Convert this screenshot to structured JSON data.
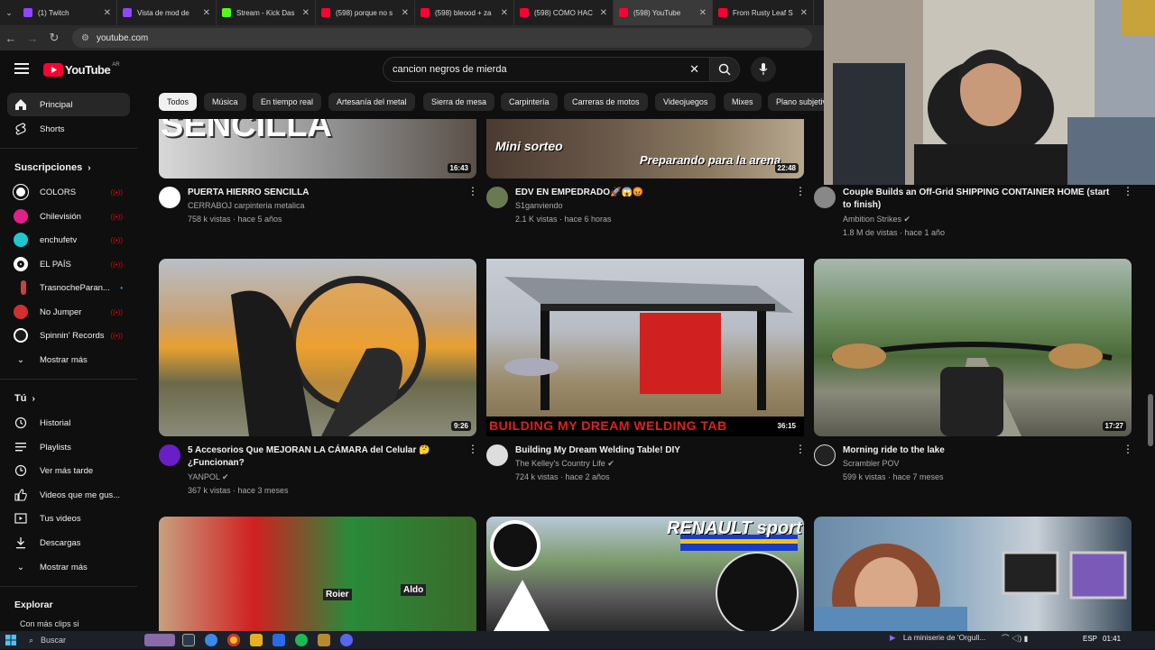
{
  "browser": {
    "tabs": [
      {
        "label": "(1) Twitch",
        "color": "#9146ff",
        "active": false
      },
      {
        "label": "Vista de mod de",
        "color": "#9146ff",
        "active": false
      },
      {
        "label": "Stream - Kick Das",
        "color": "#53fc18",
        "active": false
      },
      {
        "label": "(598) porque no s",
        "color": "#ff0033",
        "active": false
      },
      {
        "label": "(598) bleood + za",
        "color": "#ff0033",
        "active": false
      },
      {
        "label": "(598) CÓMO HAC",
        "color": "#ff0033",
        "active": false
      },
      {
        "label": "(598) YouTube",
        "color": "#ff0033",
        "active": true
      },
      {
        "label": "From Rusty Leaf S",
        "color": "#ff0033",
        "active": false
      }
    ],
    "url": "youtube.com"
  },
  "youtube": {
    "logo_text": "YouTube",
    "region": "AR",
    "search_query": "cancion negros de mierda",
    "accent": "#ff0033"
  },
  "sidebar": {
    "main": [
      {
        "label": "Principal",
        "icon": "home-icon"
      },
      {
        "label": "Shorts",
        "icon": "shorts-icon"
      }
    ],
    "subscriptions_title": "Suscripciones",
    "subscriptions": [
      {
        "label": "COLORS",
        "color": "#ffffff",
        "live": true
      },
      {
        "label": "Chilevisión",
        "color": "#e0218a",
        "live": true
      },
      {
        "label": "enchufetv",
        "color": "#1ec8d0",
        "live": true
      },
      {
        "label": "EL PAÍS",
        "color": "#ffffff",
        "live": true
      },
      {
        "label": "TrasnocheParan...",
        "color": "#c84040",
        "live": false
      },
      {
        "label": "No Jumper",
        "color": "#d03030",
        "live": true
      },
      {
        "label": "Spinnin' Records",
        "color": "#1a1a1a",
        "live": true
      }
    ],
    "show_more_subs": "Mostrar más",
    "you_title": "Tú",
    "you_items": [
      {
        "label": "Historial",
        "icon": "history-icon"
      },
      {
        "label": "Playlists",
        "icon": "playlists-icon"
      },
      {
        "label": "Ver más tarde",
        "icon": "watch-later-icon"
      },
      {
        "label": "Videos que me gus...",
        "icon": "like-icon"
      },
      {
        "label": "Tus videos",
        "icon": "your-videos-icon"
      },
      {
        "label": "Descargas",
        "icon": "download-icon"
      }
    ],
    "show_more_you": "Mostrar más",
    "explore_title": "Explorar",
    "bottom_text": "Con más clips si"
  },
  "chips": [
    "Todos",
    "Música",
    "En tiempo real",
    "Artesanía del metal",
    "Sierra de mesa",
    "Carpintería",
    "Carreras de motos",
    "Videojuegos",
    "Mixes",
    "Plano subjetivo"
  ],
  "videos": [
    {
      "title": "PUERTA HIERRO SENCILLA",
      "channel": "CERRABOJ carpinteria metalica",
      "meta": "758 k vistas · hace 5 años",
      "duration": "16:43",
      "thumb_text": "SENCILLA",
      "verified": false
    },
    {
      "title": "EDV EN EMPEDRADO🚀😱😡",
      "channel": "S1ganviendo",
      "meta": "2.1 K vistas · hace 6 horas",
      "duration": "22:48",
      "thumb_text": "Mini sorteo",
      "thumb_text2": "Preparando para la arena",
      "verified": false
    },
    {
      "title": "Couple Builds an Off-Grid SHIPPING CONTAINER HOME (start to finish)",
      "channel": "Ambition Strikes",
      "meta": "1.8 M de vistas · hace 1 año",
      "duration": "",
      "verified": true
    },
    {
      "title": "5 Accesorios Que MEJORAN LA CÁMARA del Celular 🤔 ¿Funcionan?",
      "channel": "YANPOL",
      "meta": "367 k vistas · hace 3 meses",
      "duration": "9:26",
      "verified": true
    },
    {
      "title": "Building My Dream Welding Table! DIY",
      "channel": "The Kelley's Country Life",
      "meta": "724 k vistas · hace 2 años",
      "duration": "36:15",
      "thumb_text": "BUILDING MY DREAM WELDING TAB",
      "verified": true
    },
    {
      "title": "Morning ride to the lake",
      "channel": "Scrambler POV",
      "meta": "599 k vistas · hace 7 meses",
      "duration": "17:27",
      "verified": false
    },
    {
      "title": "",
      "channel": "",
      "meta": "",
      "duration": "",
      "thumb_text": "Roier",
      "thumb_text2": "Aldo"
    },
    {
      "title": "",
      "channel": "",
      "meta": "",
      "duration": "",
      "thumb_text": "RENAULT sport"
    },
    {
      "title": "",
      "channel": "",
      "meta": "",
      "duration": ""
    }
  ],
  "taskbar": {
    "search_label": "Buscar",
    "media_text": "La miniserie de 'Orgull...",
    "lang": "ESP",
    "clock": "01:41"
  }
}
